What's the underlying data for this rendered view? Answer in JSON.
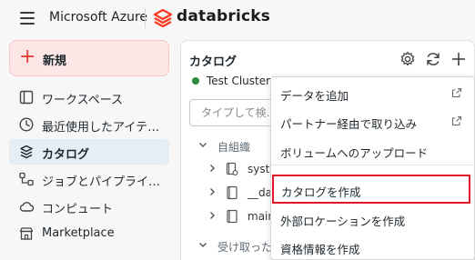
{
  "header": {
    "menu_icon": "hamburger-icon",
    "brand_left": "Microsoft Azure",
    "logo_icon": "databricks-logo-icon",
    "brand_right": "databricks"
  },
  "sidebar": {
    "new_button": {
      "icon": "plus-icon",
      "label": "新規"
    },
    "items": [
      {
        "icon": "workspace-icon",
        "label": "ワークスペース",
        "active": false
      },
      {
        "icon": "clock-icon",
        "label": "最近使用したアイテ…",
        "active": false
      },
      {
        "icon": "catalog-icon",
        "label": "カタログ",
        "active": true
      },
      {
        "icon": "workflow-icon",
        "label": "ジョブとパイプライ…",
        "active": false
      },
      {
        "icon": "cloud-icon",
        "label": "コンピュート",
        "active": false
      },
      {
        "icon": "store-icon",
        "label": "Marketplace",
        "active": false
      }
    ]
  },
  "catalog_panel": {
    "title": "カタログ",
    "actions": [
      "gear-icon",
      "refresh-icon",
      "plus-icon"
    ],
    "cluster": {
      "status_color": "#2e8b3e",
      "label": "Test Cluster"
    },
    "search": {
      "placeholder": "タイプして検…"
    },
    "tree": [
      {
        "kind": "section",
        "label": "自組織"
      },
      {
        "kind": "item",
        "label": "syste",
        "icon": "catalog-settings-icon"
      },
      {
        "kind": "item",
        "label": "__da",
        "icon": "catalog-icon"
      },
      {
        "kind": "item",
        "label": "main",
        "icon": "catalog-icon"
      },
      {
        "kind": "section",
        "label": "受け取った"
      }
    ]
  },
  "dropdown_menu": {
    "items": [
      {
        "label": "データを追加",
        "external": true
      },
      {
        "label": "パートナー経由で取り込み",
        "external": true
      },
      {
        "label": "ボリュームへのアップロード",
        "external": false
      },
      {
        "label": "カタログを作成",
        "external": false,
        "highlighted": true
      },
      {
        "label": "外部ロケーションを作成",
        "external": false
      },
      {
        "label": "資格情報を作成",
        "external": false
      }
    ],
    "highlight_color": "#e0152a"
  }
}
